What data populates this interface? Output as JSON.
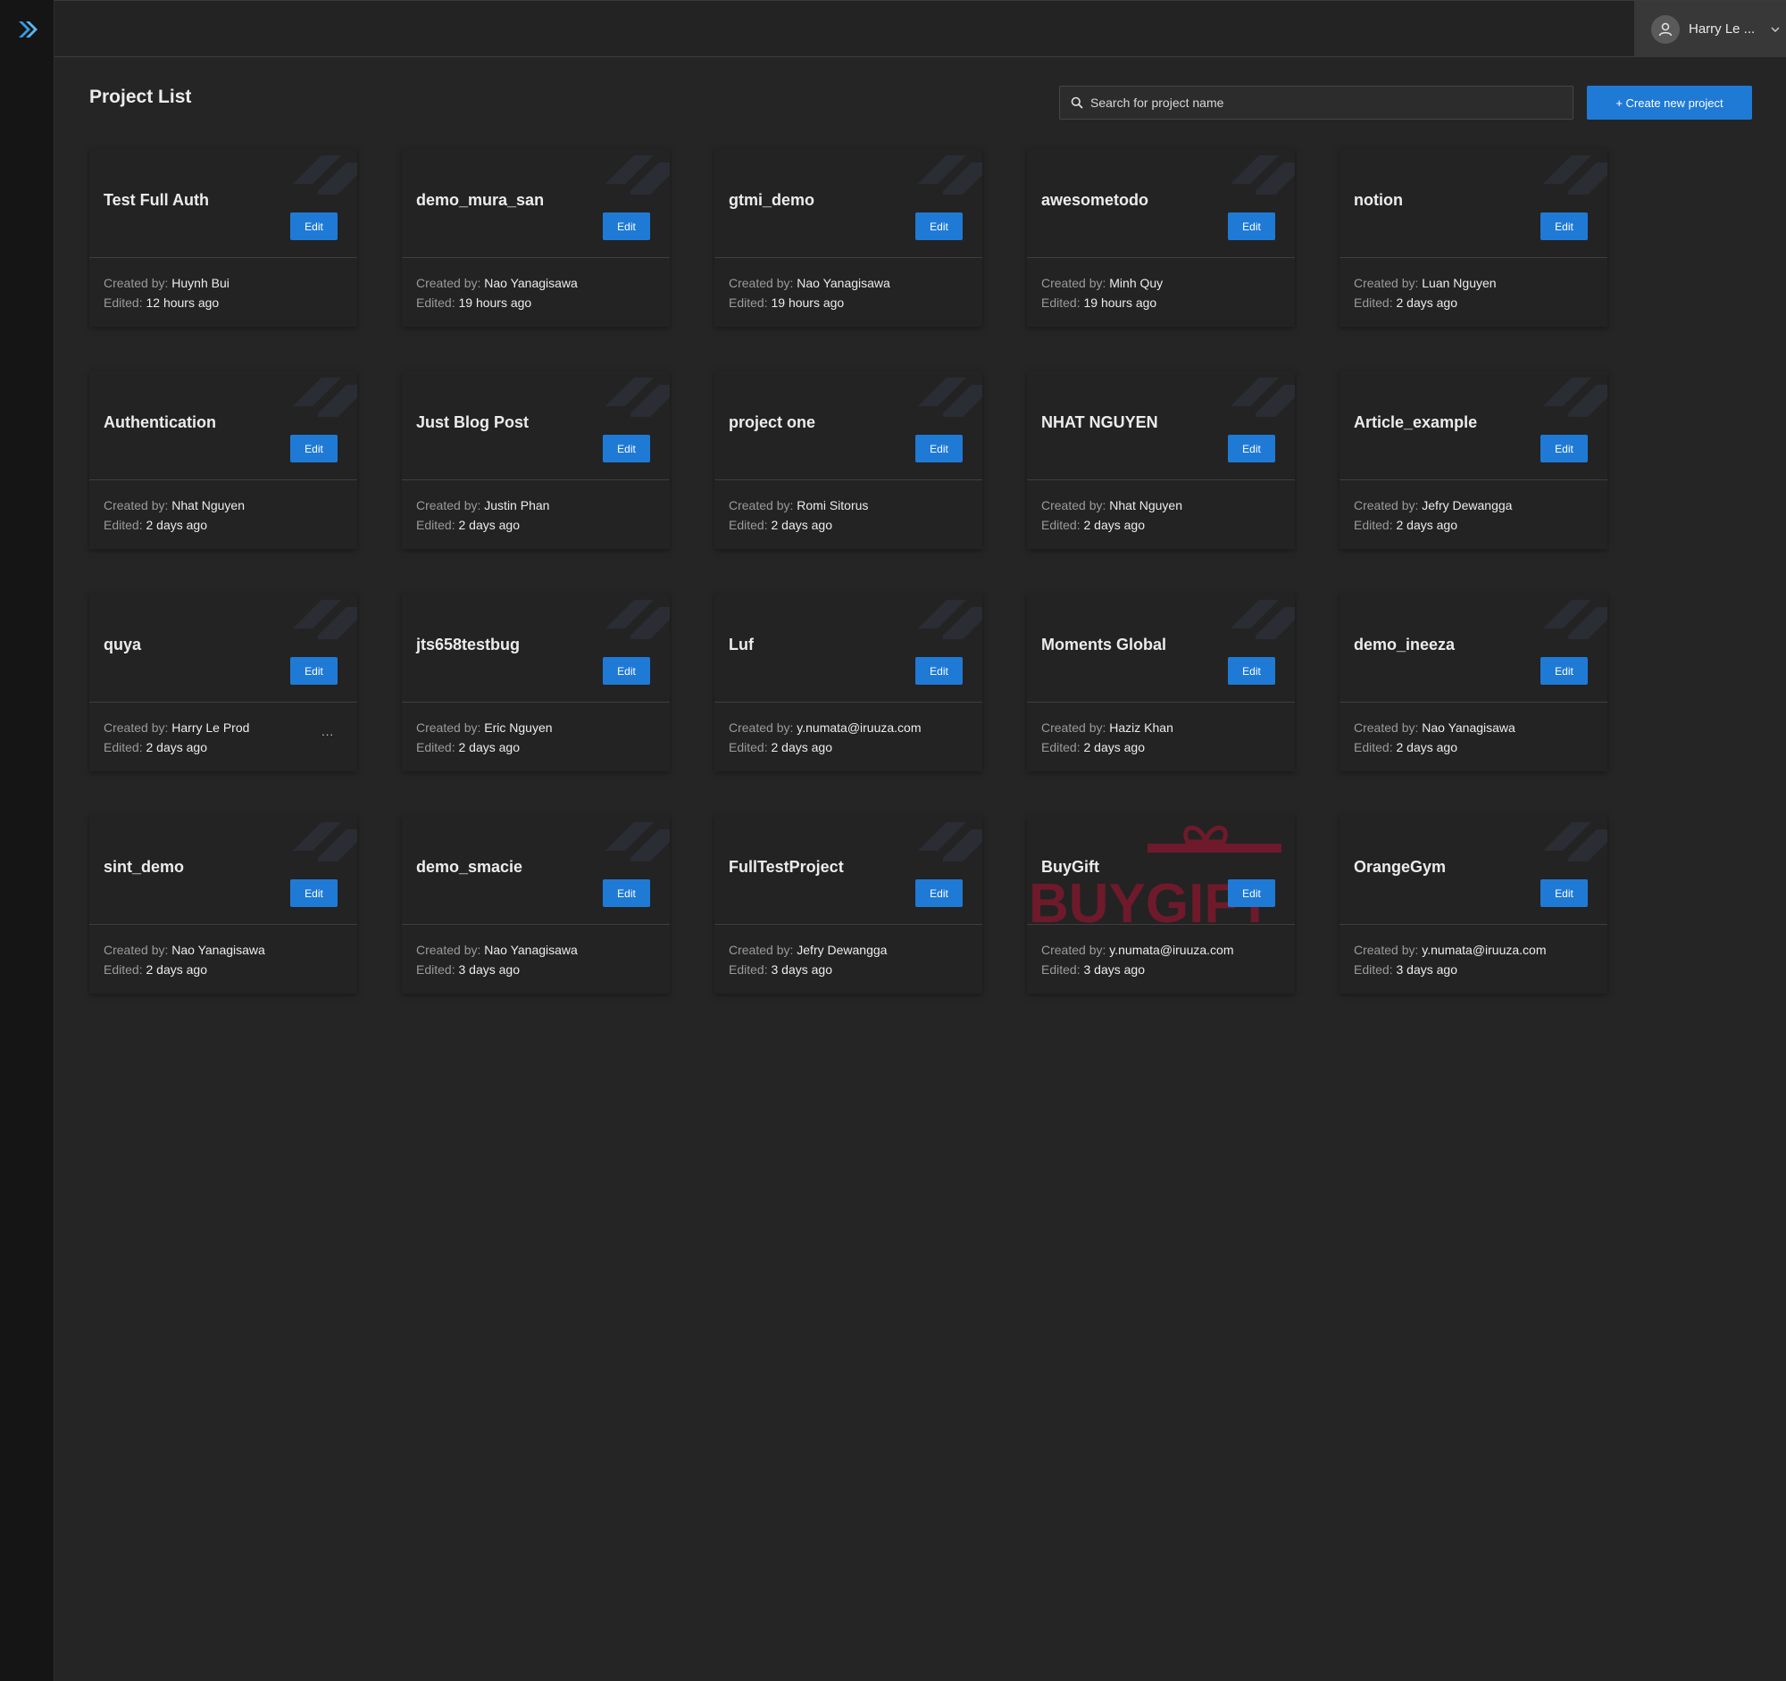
{
  "header": {
    "user_name": "Harry Le ..."
  },
  "page": {
    "title": "Project List"
  },
  "search": {
    "placeholder": "Search for project name",
    "value": ""
  },
  "create_button": {
    "label": "+ Create new project"
  },
  "labels": {
    "created_by": "Created by:",
    "edited": "Edited:",
    "edit": "Edit",
    "more": "..."
  },
  "colors": {
    "accent": "#1f7ad6",
    "background": "#252525",
    "card": "#232323",
    "sidebar": "#151515"
  },
  "projects": [
    {
      "name": "Test Full Auth",
      "created_by": "Huynh Bui",
      "edited": "12 hours ago"
    },
    {
      "name": "demo_mura_san",
      "created_by": "Nao Yanagisawa",
      "edited": "19 hours ago"
    },
    {
      "name": "gtmi_demo",
      "created_by": "Nao Yanagisawa",
      "edited": "19 hours ago"
    },
    {
      "name": "awesometodo",
      "created_by": "Minh Quy",
      "edited": "19 hours ago"
    },
    {
      "name": "notion",
      "created_by": "Luan Nguyen",
      "edited": "2 days ago"
    },
    {
      "name": "Authentication",
      "created_by": "Nhat Nguyen",
      "edited": "2 days ago"
    },
    {
      "name": "Just Blog Post",
      "created_by": "Justin Phan",
      "edited": "2 days ago"
    },
    {
      "name": "project one",
      "created_by": "Romi Sitorus",
      "edited": "2 days ago"
    },
    {
      "name": "NHAT NGUYEN",
      "created_by": "Nhat Nguyen",
      "edited": "2 days ago"
    },
    {
      "name": "Article_example",
      "created_by": "Jefry Dewangga",
      "edited": "2 days ago"
    },
    {
      "name": "quya",
      "created_by": "Harry Le Prod",
      "edited": "2 days ago",
      "has_menu": true
    },
    {
      "name": "jts658testbug",
      "created_by": "Eric Nguyen",
      "edited": "2 days ago"
    },
    {
      "name": "Luf",
      "created_by": "y.numata@iruuza.com",
      "edited": "2 days ago"
    },
    {
      "name": "Moments Global",
      "created_by": "Haziz Khan",
      "edited": "2 days ago"
    },
    {
      "name": "demo_ineeza",
      "created_by": "Nao Yanagisawa",
      "edited": "2 days ago"
    },
    {
      "name": "sint_demo",
      "created_by": "Nao Yanagisawa",
      "edited": "2 days ago"
    },
    {
      "name": "demo_smacie",
      "created_by": "Nao Yanagisawa",
      "edited": "3 days ago"
    },
    {
      "name": "FullTestProject",
      "created_by": "Jefry Dewangga",
      "edited": "3 days ago"
    },
    {
      "name": "BuyGift",
      "created_by": "y.numata@iruuza.com",
      "edited": "3 days ago",
      "thumbnail": "buygift-logo",
      "thumbnail_text": "BUYGIFT"
    },
    {
      "name": "OrangeGym",
      "created_by": "y.numata@iruuza.com",
      "edited": "3 days ago"
    }
  ]
}
